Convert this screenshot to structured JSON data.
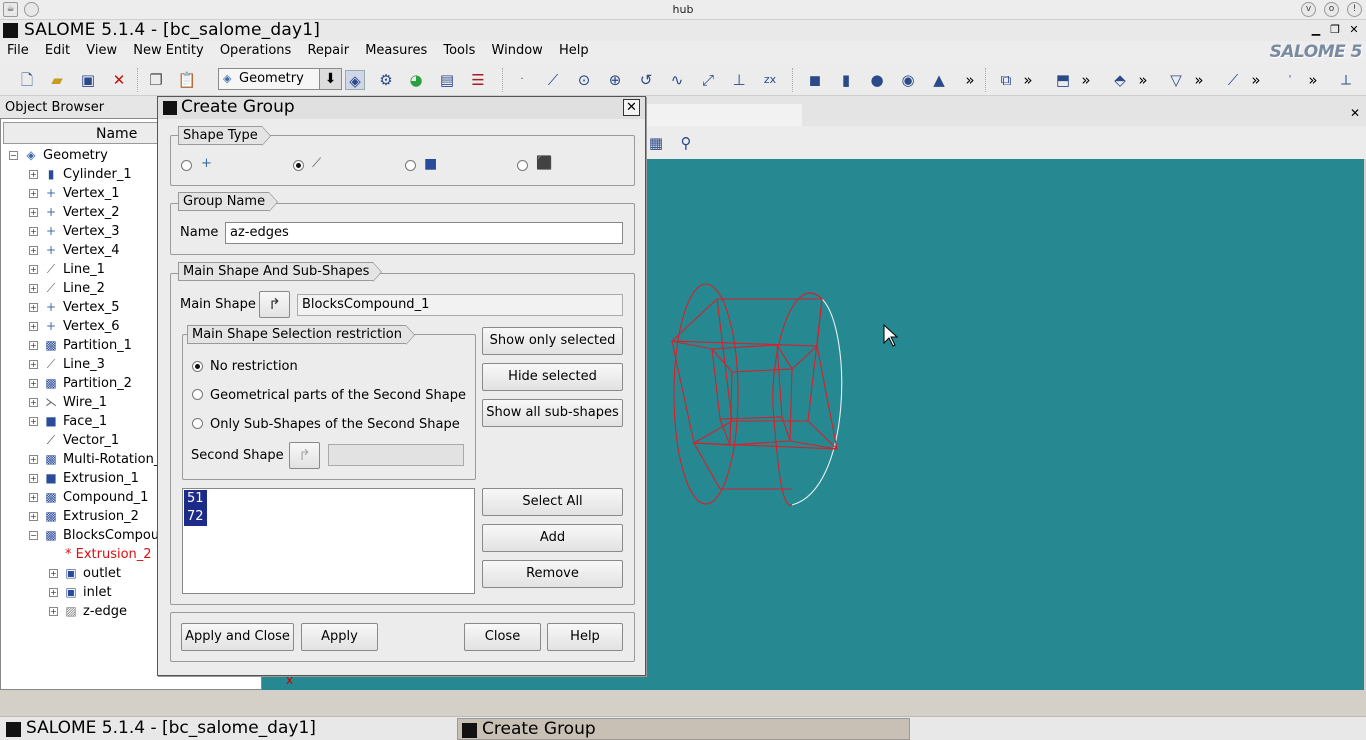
{
  "wm": {
    "host": "hub",
    "buttons": [
      "v",
      "o",
      "!"
    ]
  },
  "app": {
    "title": "SALOME 5.1.4 - [bc_salome_day1]",
    "logo": "SALOME 5"
  },
  "menu": [
    "File",
    "Edit",
    "View",
    "New Entity",
    "Operations",
    "Repair",
    "Measures",
    "Tools",
    "Window",
    "Help"
  ],
  "toolbar": {
    "module": "Geometry"
  },
  "object_browser": {
    "title": "Object Browser",
    "column": "Name",
    "items": [
      {
        "label": "Geometry",
        "icon": "geometry-icon",
        "expander": "−"
      },
      {
        "label": "Cylinder_1",
        "icon": "cylinder-icon",
        "expander": "+"
      },
      {
        "label": "Vertex_1",
        "icon": "vertex-icon",
        "expander": "+"
      },
      {
        "label": "Vertex_2",
        "icon": "vertex-icon",
        "expander": "+"
      },
      {
        "label": "Vertex_3",
        "icon": "vertex-icon",
        "expander": "+"
      },
      {
        "label": "Vertex_4",
        "icon": "vertex-icon",
        "expander": "+"
      },
      {
        "label": "Line_1",
        "icon": "line-icon",
        "expander": "+"
      },
      {
        "label": "Line_2",
        "icon": "line-icon",
        "expander": "+"
      },
      {
        "label": "Vertex_5",
        "icon": "vertex-icon",
        "expander": "+"
      },
      {
        "label": "Vertex_6",
        "icon": "vertex-icon",
        "expander": "+"
      },
      {
        "label": "Partition_1",
        "icon": "partition-icon",
        "expander": "+"
      },
      {
        "label": "Line_3",
        "icon": "line-icon",
        "expander": "+"
      },
      {
        "label": "Partition_2",
        "icon": "partition-icon",
        "expander": "+"
      },
      {
        "label": "Wire_1",
        "icon": "wire-icon",
        "expander": "+"
      },
      {
        "label": "Face_1",
        "icon": "face-icon",
        "expander": "+"
      },
      {
        "label": "Vector_1",
        "icon": "vector-icon",
        "expander": ""
      },
      {
        "label": "Multi-Rotation_",
        "icon": "partition-icon",
        "expander": "+"
      },
      {
        "label": "Extrusion_1",
        "icon": "face-icon",
        "expander": "+"
      },
      {
        "label": "Compound_1",
        "icon": "partition-icon",
        "expander": "+"
      },
      {
        "label": "Extrusion_2",
        "icon": "partition-icon",
        "expander": "+"
      },
      {
        "label": "BlocksCompou",
        "icon": "partition-icon",
        "expander": "−"
      },
      {
        "label": "* Extrusion_2",
        "icon": "",
        "expander": "",
        "child": true,
        "red": true
      },
      {
        "label": "outlet",
        "icon": "group-icon",
        "expander": "+",
        "child": true
      },
      {
        "label": "inlet",
        "icon": "group-icon",
        "expander": "+",
        "child": true
      },
      {
        "label": "z-edge",
        "icon": "edge-group-icon",
        "expander": "+",
        "child": true
      }
    ]
  },
  "dialog": {
    "title": "Create Group",
    "shape_type": {
      "title": "Shape Type",
      "options": [
        "vertex-icon",
        "edge-icon",
        "face-icon",
        "solid-icon"
      ],
      "selected": 1
    },
    "group_name": {
      "title": "Group Name",
      "label": "Name",
      "value": "az-edges"
    },
    "main_shape": {
      "title": "Main Shape And Sub-Shapes",
      "label": "Main Shape",
      "value": "BlocksCompound_1",
      "restriction": {
        "title": "Main Shape Selection restriction",
        "options": [
          "No restriction",
          "Geometrical parts of the Second Shape",
          "Only Sub-Shapes of the Second Shape"
        ],
        "selected": 0,
        "second_label": "Second Shape",
        "second_value": ""
      },
      "buttons": [
        "Show only selected",
        "Hide selected",
        "Show all sub-shapes"
      ],
      "ids": [
        "51",
        "72"
      ],
      "list_buttons": [
        "Select All",
        "Add",
        "Remove"
      ]
    },
    "footer": {
      "apply_close": "Apply and Close",
      "apply": "Apply",
      "close": "Close",
      "help": "Help"
    }
  },
  "taskbar": {
    "items": [
      "SALOME 5.1.4 - [bc_salome_day1]",
      "Create Group"
    ]
  },
  "colors": {
    "viewer_bg": "#268891",
    "wire_red": "#d8202a",
    "wire_white": "#e8f0f0",
    "selection": "#1c2a8a"
  }
}
